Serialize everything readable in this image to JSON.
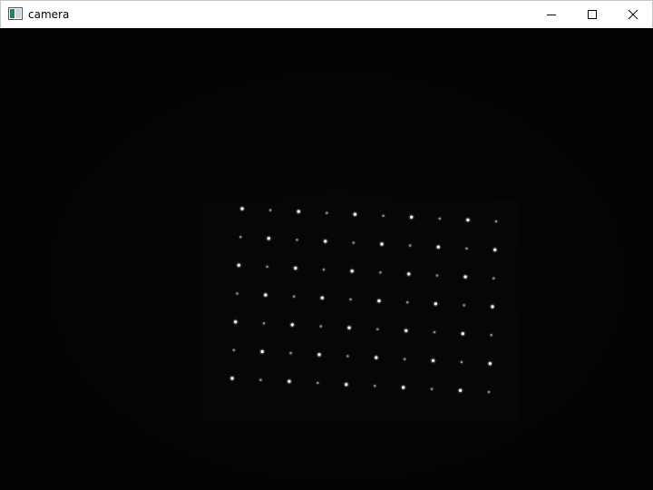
{
  "window": {
    "title": "camera",
    "icon": "window-app-icon",
    "controls": {
      "minimize": "minimize-icon",
      "maximize": "maximize-icon",
      "close": "close-icon"
    }
  },
  "camera_view": {
    "description_colors": {
      "background": "#020202",
      "dot_bright": "#ffffff",
      "dot_dim": "#8a8a8a"
    }
  }
}
